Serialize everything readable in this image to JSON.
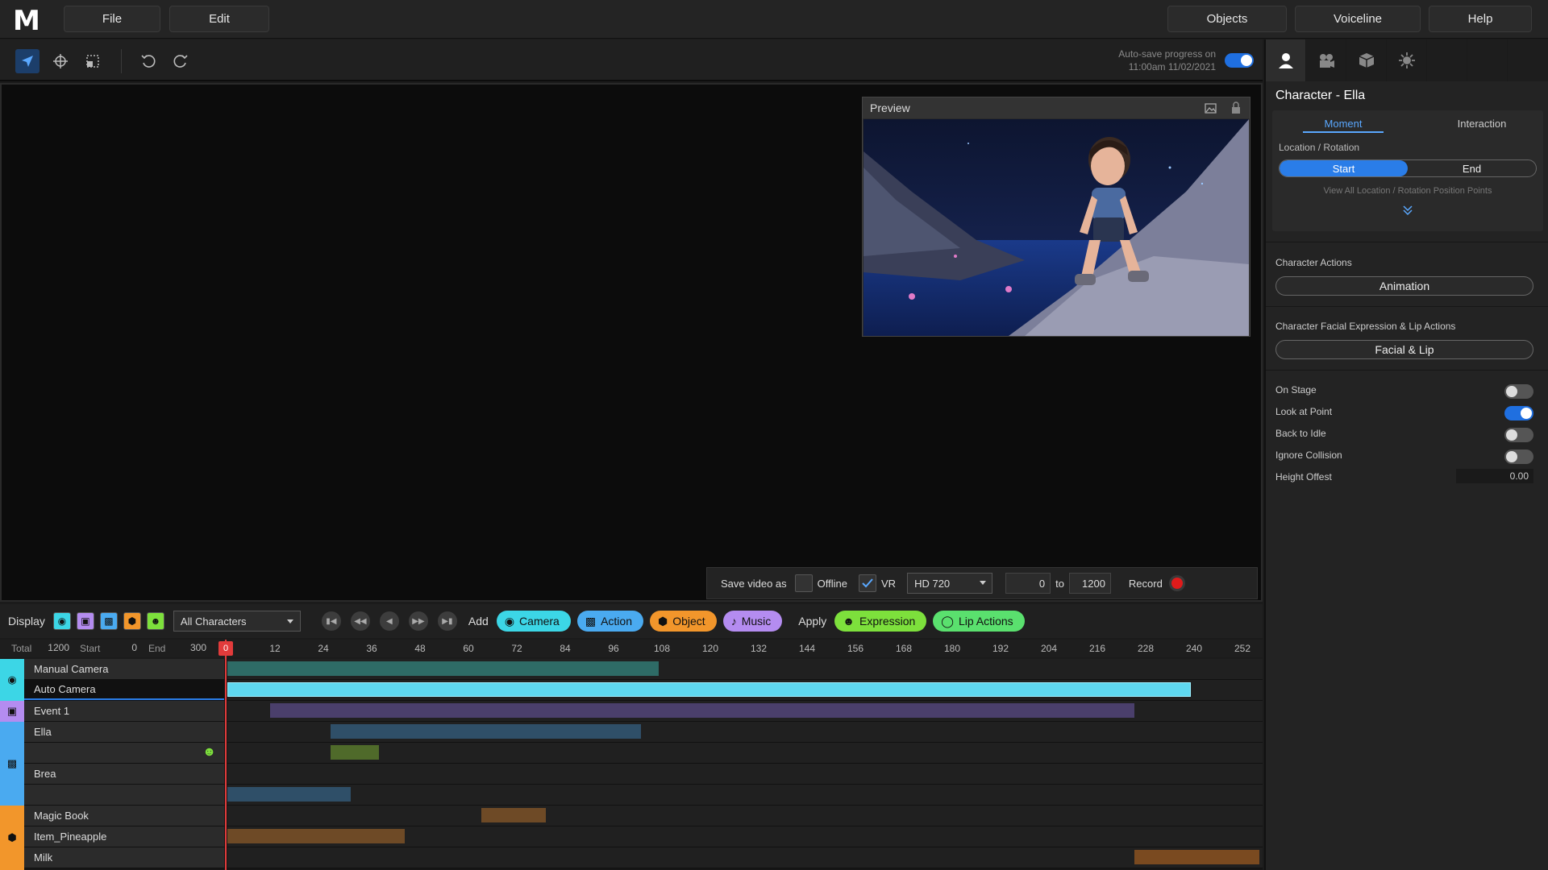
{
  "menubar": {
    "logo": "M",
    "file": "File",
    "edit": "Edit",
    "objects": "Objects",
    "voiceline": "Voiceline",
    "help": "Help"
  },
  "toolbar": {
    "tools": [
      "select-arrow-icon",
      "move-gizmo-icon",
      "scale-icon"
    ],
    "undo_icon": "undo-icon",
    "redo_icon": "redo-icon",
    "autosave_line1": "Auto-save progress on",
    "autosave_line2": "11:00am 11/02/2021",
    "autosave_enabled": true
  },
  "preview": {
    "title": "Preview"
  },
  "savebar": {
    "label": "Save video as",
    "offline_label": "Offline",
    "offline_checked": false,
    "vr_label": "VR",
    "vr_checked": true,
    "resolution": "HD 720",
    "range_from": "0",
    "range_to_word": "to",
    "range_to": "1200",
    "record_label": "Record"
  },
  "timeline_bar": {
    "display_label": "Display",
    "filter": "All Characters",
    "add_label": "Add",
    "add_buttons": [
      {
        "label": "Camera",
        "color": "#3cd6e6"
      },
      {
        "label": "Action",
        "color": "#4aaaf0"
      },
      {
        "label": "Object",
        "color": "#f2962b"
      },
      {
        "label": "Music",
        "color": "#b48cf0"
      }
    ],
    "apply_label": "Apply",
    "apply_buttons": [
      {
        "label": "Expression",
        "color": "#7de03c"
      },
      {
        "label": "Lip Actions",
        "color": "#5ae06e"
      }
    ]
  },
  "ruler": {
    "total_label": "Total",
    "total": "1200",
    "start_label": "Start",
    "start": "0",
    "end_label": "End",
    "end": "300",
    "playhead": "0",
    "ticks": [
      "12",
      "24",
      "36",
      "48",
      "60",
      "72",
      "84",
      "96",
      "108",
      "120",
      "132",
      "144",
      "156",
      "168",
      "180",
      "192",
      "204",
      "216",
      "228",
      "240",
      "252"
    ]
  },
  "tracks": [
    {
      "label": "Manual Camera",
      "color": "#2e6b66",
      "start": 0,
      "end": 107
    },
    {
      "label": "Auto Camera",
      "color": "#5fd8f0",
      "start": 0,
      "end": 239,
      "selected": true
    },
    {
      "label": "Event 1",
      "color": "#4a3f6b",
      "start": 10.5,
      "end": 225
    },
    {
      "label": "Ella",
      "color": "#2f4f68",
      "start": 25.5,
      "end": 102.5
    },
    {
      "label": "",
      "color": "#4f6a2a",
      "start": 25.5,
      "end": 37.5,
      "icon": "smiley-icon"
    },
    {
      "label": "Brea",
      "color": "",
      "start": 0,
      "end": 0
    },
    {
      "label": "",
      "color": "#2f4f68",
      "start": 0,
      "end": 30.5
    },
    {
      "label": "Magic Book",
      "color": "#6e4a26",
      "start": 63,
      "end": 79
    },
    {
      "label": "Item_Pineapple",
      "color": "#6e4a26",
      "start": 0,
      "end": 44
    },
    {
      "label": "Milk",
      "color": "#7a4a20",
      "start": 225,
      "end": 256
    }
  ],
  "panel": {
    "title": "Character  -  Ella",
    "tab_moment": "Moment",
    "tab_interaction": "Interaction",
    "loc_rot_label": "Location / Rotation",
    "start_btn": "Start",
    "end_btn": "End",
    "view_all": "View All Location / Rotation Position Points",
    "char_actions_label": "Character Actions",
    "animation_btn": "Animation",
    "facial_label": "Character Facial Expression & Lip Actions",
    "facial_btn": "Facial & Lip",
    "options": [
      {
        "label": "On Stage",
        "on": false
      },
      {
        "label": "Look at Point",
        "on": true
      },
      {
        "label": "Back to Idle",
        "on": false
      },
      {
        "label": "Ignore Collision",
        "on": false
      }
    ],
    "height_offset_label": "Height Offest",
    "height_offset": "0.00"
  }
}
